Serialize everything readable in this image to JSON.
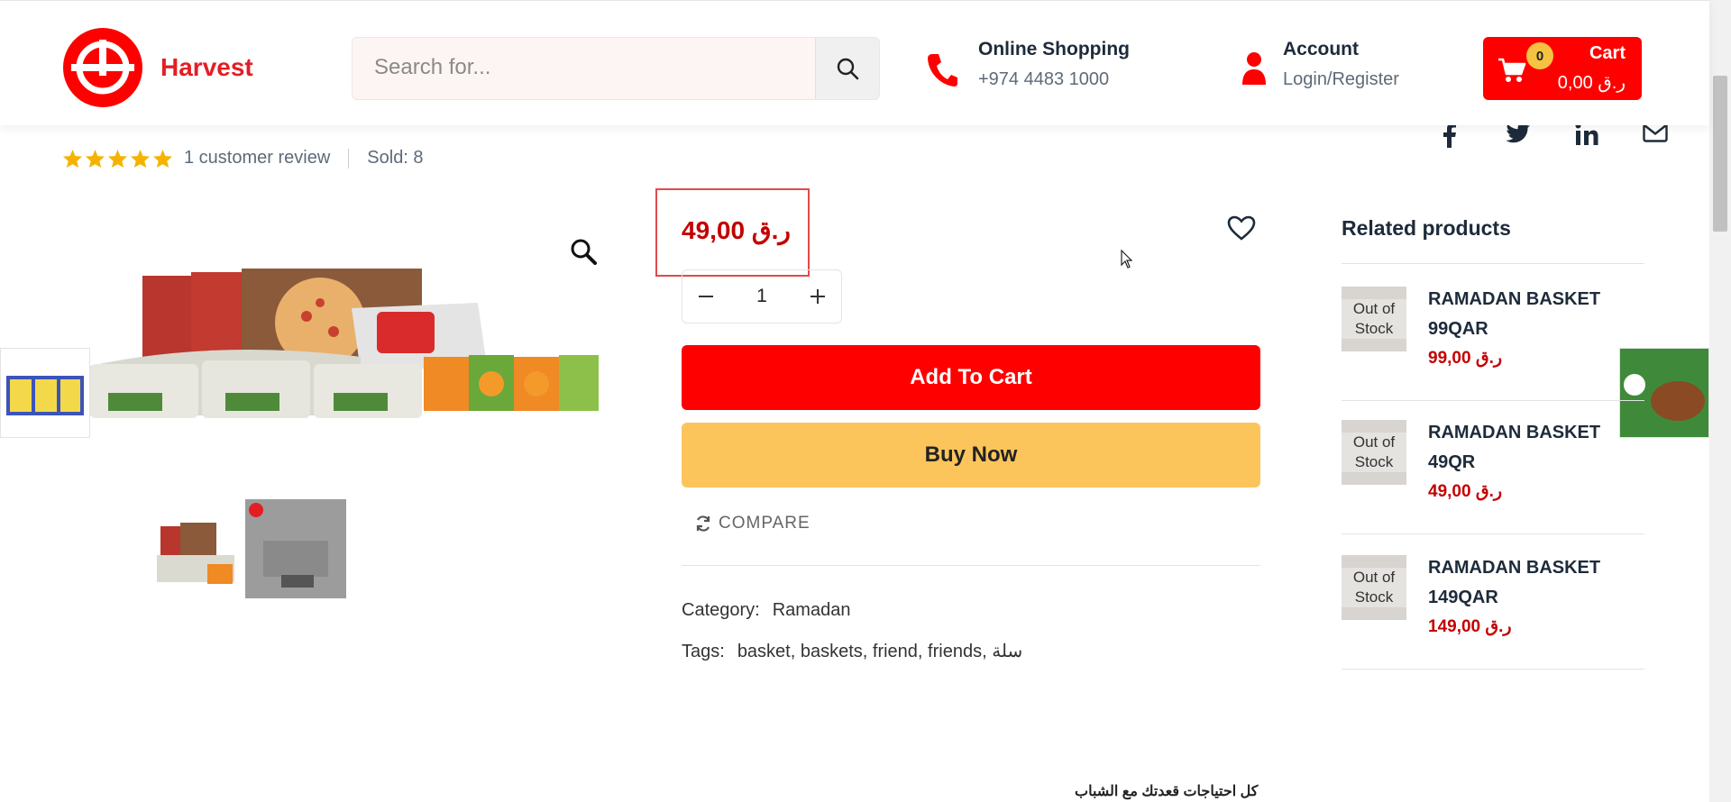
{
  "header": {
    "logo_text": "Harvest",
    "search_placeholder": "Search for...",
    "contact_title": "Online Shopping",
    "contact_phone": "+974 4483 1000",
    "account_title": "Account",
    "account_link": "Login/Register",
    "cart_count": "0",
    "cart_label": "Cart",
    "cart_total": "0,00 ر.ق"
  },
  "product": {
    "review_text": "1 customer review",
    "sold_text": "Sold: 8",
    "rating": 5,
    "price": "49,00 ر.ق",
    "quantity": "1",
    "add_to_cart": "Add To Cart",
    "buy_now": "Buy Now",
    "compare": "COMPARE",
    "category_label": "Category:",
    "category_value": "Ramadan",
    "tags_label": "Tags:",
    "tags_value": "basket, baskets, friend, friends, سلة",
    "description_snippet": "كل احتياجات قعدتك مع الشباب"
  },
  "related": {
    "title": "Related products",
    "items": [
      {
        "badge": "Out of Stock",
        "name": "RAMADAN BASKET 99QAR",
        "price": "99,00 ر.ق"
      },
      {
        "badge": "Out of Stock",
        "name": "RAMADAN BASKET 49QR",
        "price": "49,00 ر.ق"
      },
      {
        "badge": "Out of Stock",
        "name": "RAMADAN BASKET 149QAR",
        "price": "149,00 ر.ق"
      }
    ]
  },
  "colors": {
    "brand_red": "#ff0000",
    "price_red": "#c40000",
    "buy_now_yellow": "#fcc55c",
    "star_yellow": "#f5b301"
  }
}
